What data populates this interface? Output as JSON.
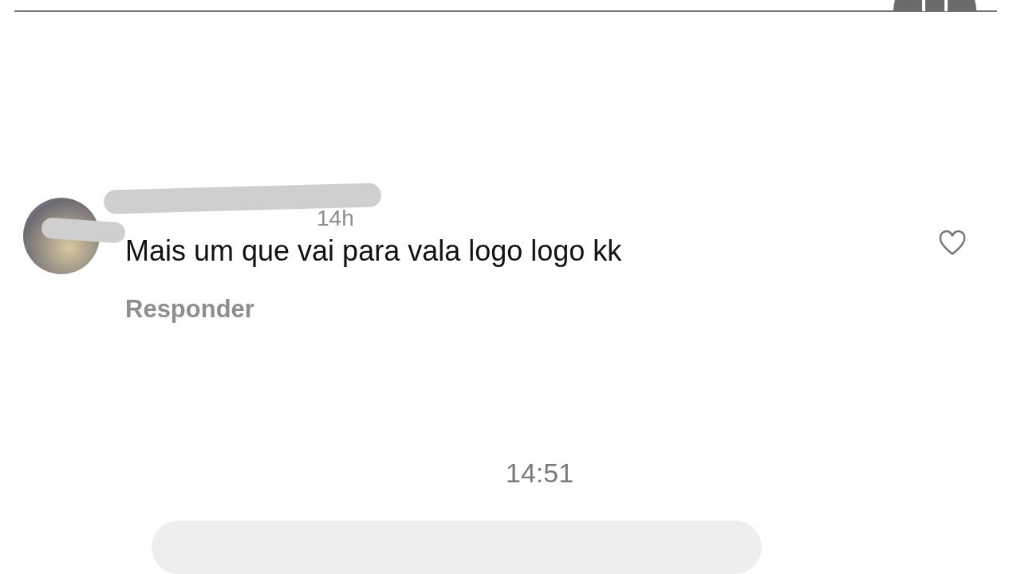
{
  "comment": {
    "time": "14h",
    "text": "Mais um que vai para vala logo logo kk",
    "reply": "Responder",
    "liked": false
  },
  "message_time": "14:51"
}
